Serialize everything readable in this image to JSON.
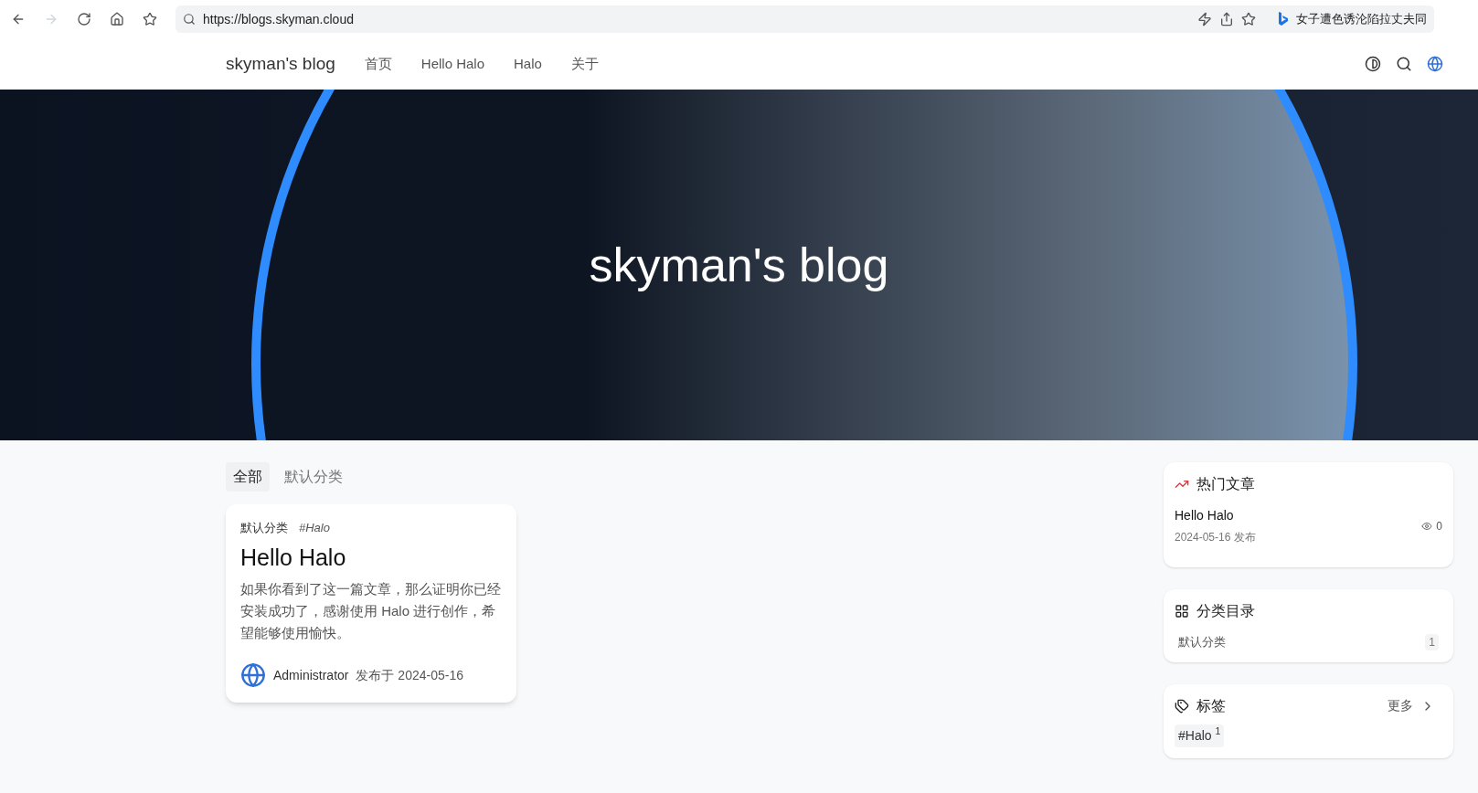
{
  "browser": {
    "url": "https://blogs.skyman.cloud",
    "news": "女子遭色诱沦陷拉丈夫同"
  },
  "nav": {
    "brand": "skyman's blog",
    "links": [
      {
        "label": "首页"
      },
      {
        "label": "Hello Halo"
      },
      {
        "label": "Halo"
      },
      {
        "label": "关于"
      }
    ]
  },
  "hero": {
    "title": "skyman's blog"
  },
  "category_tabs": [
    {
      "label": "全部",
      "selected": true
    },
    {
      "label": "默认分类",
      "selected": false
    }
  ],
  "posts": [
    {
      "category": "默认分类",
      "tag": "#Halo",
      "title": "Hello Halo",
      "excerpt": "如果你看到了这一篇文章，那么证明你已经安装成功了，感谢使用 Halo 进行创作，希望能够使用愉快。",
      "author": "Administrator",
      "date": "发布于 2024-05-16"
    }
  ],
  "hot_posts": {
    "title": "热门文章",
    "items": [
      {
        "title": "Hello Halo",
        "date": "2024-05-16 发布",
        "views": "0"
      }
    ]
  },
  "categories": {
    "title": "分类目录",
    "items": [
      {
        "name": "默认分类",
        "count": "1"
      }
    ]
  },
  "tags": {
    "title": "标签",
    "more": "更多",
    "items": [
      {
        "name": "#Halo",
        "count": "1"
      }
    ]
  }
}
